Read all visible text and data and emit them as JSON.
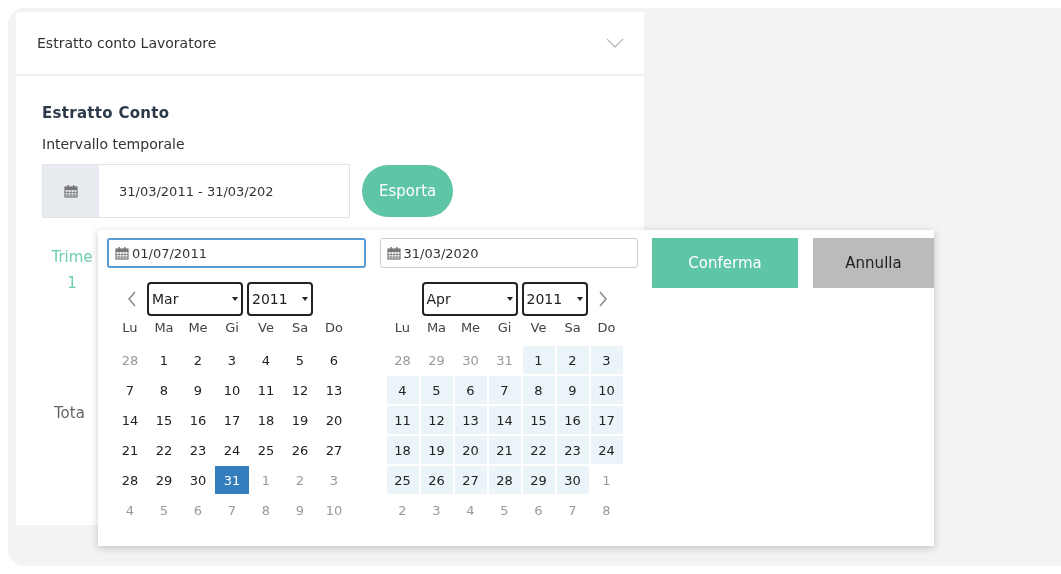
{
  "card": {
    "title": "Estratto conto Lavoratore",
    "expanded": false
  },
  "section": {
    "heading": "Estratto Conto",
    "label": "Intervallo temporale",
    "range_value": "31/03/2011 - 31/03/202",
    "export_button": "Esporta"
  },
  "behind": {
    "column_1_header": "Trime",
    "column_1_value": "1",
    "total_label": "Tota"
  },
  "picker": {
    "start_value": "01/07/2011",
    "end_value": "31/03/2020",
    "confirm_button": "Conferma",
    "cancel_button": "Annulla",
    "calendars": [
      {
        "month": "Mar",
        "year": "2011",
        "weekdays": [
          "Lu",
          "Ma",
          "Me",
          "Gi",
          "Ve",
          "Sa",
          "Do"
        ],
        "days": [
          {
            "d": "28",
            "kind": "off"
          },
          {
            "d": "1",
            "kind": "day"
          },
          {
            "d": "2",
            "kind": "day"
          },
          {
            "d": "3",
            "kind": "day"
          },
          {
            "d": "4",
            "kind": "day"
          },
          {
            "d": "5",
            "kind": "day"
          },
          {
            "d": "6",
            "kind": "day"
          },
          {
            "d": "7",
            "kind": "day"
          },
          {
            "d": "8",
            "kind": "day"
          },
          {
            "d": "9",
            "kind": "day"
          },
          {
            "d": "10",
            "kind": "day"
          },
          {
            "d": "11",
            "kind": "day"
          },
          {
            "d": "12",
            "kind": "day"
          },
          {
            "d": "13",
            "kind": "day"
          },
          {
            "d": "14",
            "kind": "day"
          },
          {
            "d": "15",
            "kind": "day"
          },
          {
            "d": "16",
            "kind": "day"
          },
          {
            "d": "17",
            "kind": "day"
          },
          {
            "d": "18",
            "kind": "day"
          },
          {
            "d": "19",
            "kind": "day"
          },
          {
            "d": "20",
            "kind": "day"
          },
          {
            "d": "21",
            "kind": "day"
          },
          {
            "d": "22",
            "kind": "day"
          },
          {
            "d": "23",
            "kind": "day"
          },
          {
            "d": "24",
            "kind": "day"
          },
          {
            "d": "25",
            "kind": "day"
          },
          {
            "d": "26",
            "kind": "day"
          },
          {
            "d": "27",
            "kind": "day"
          },
          {
            "d": "28",
            "kind": "day"
          },
          {
            "d": "29",
            "kind": "day"
          },
          {
            "d": "30",
            "kind": "day"
          },
          {
            "d": "31",
            "kind": "selected"
          },
          {
            "d": "1",
            "kind": "off"
          },
          {
            "d": "2",
            "kind": "off"
          },
          {
            "d": "3",
            "kind": "off"
          },
          {
            "d": "4",
            "kind": "off"
          },
          {
            "d": "5",
            "kind": "off"
          },
          {
            "d": "6",
            "kind": "off"
          },
          {
            "d": "7",
            "kind": "off"
          },
          {
            "d": "8",
            "kind": "off"
          },
          {
            "d": "9",
            "kind": "off"
          },
          {
            "d": "10",
            "kind": "off"
          }
        ]
      },
      {
        "month": "Apr",
        "year": "2011",
        "weekdays": [
          "Lu",
          "Ma",
          "Me",
          "Gi",
          "Ve",
          "Sa",
          "Do"
        ],
        "days": [
          {
            "d": "28",
            "kind": "off"
          },
          {
            "d": "29",
            "kind": "off"
          },
          {
            "d": "30",
            "kind": "off"
          },
          {
            "d": "31",
            "kind": "off"
          },
          {
            "d": "1",
            "kind": "range"
          },
          {
            "d": "2",
            "kind": "range"
          },
          {
            "d": "3",
            "kind": "range"
          },
          {
            "d": "4",
            "kind": "range"
          },
          {
            "d": "5",
            "kind": "range"
          },
          {
            "d": "6",
            "kind": "range"
          },
          {
            "d": "7",
            "kind": "range"
          },
          {
            "d": "8",
            "kind": "range"
          },
          {
            "d": "9",
            "kind": "range"
          },
          {
            "d": "10",
            "kind": "range"
          },
          {
            "d": "11",
            "kind": "range"
          },
          {
            "d": "12",
            "kind": "range"
          },
          {
            "d": "13",
            "kind": "range"
          },
          {
            "d": "14",
            "kind": "range"
          },
          {
            "d": "15",
            "kind": "range"
          },
          {
            "d": "16",
            "kind": "range"
          },
          {
            "d": "17",
            "kind": "range"
          },
          {
            "d": "18",
            "kind": "range"
          },
          {
            "d": "19",
            "kind": "range"
          },
          {
            "d": "20",
            "kind": "range"
          },
          {
            "d": "21",
            "kind": "range"
          },
          {
            "d": "22",
            "kind": "range"
          },
          {
            "d": "23",
            "kind": "range"
          },
          {
            "d": "24",
            "kind": "range"
          },
          {
            "d": "25",
            "kind": "range"
          },
          {
            "d": "26",
            "kind": "range"
          },
          {
            "d": "27",
            "kind": "range"
          },
          {
            "d": "28",
            "kind": "range"
          },
          {
            "d": "29",
            "kind": "range"
          },
          {
            "d": "30",
            "kind": "range"
          },
          {
            "d": "1",
            "kind": "off"
          },
          {
            "d": "2",
            "kind": "off"
          },
          {
            "d": "3",
            "kind": "off"
          },
          {
            "d": "4",
            "kind": "off"
          },
          {
            "d": "5",
            "kind": "off"
          },
          {
            "d": "6",
            "kind": "off"
          },
          {
            "d": "7",
            "kind": "off"
          },
          {
            "d": "8",
            "kind": "off"
          }
        ]
      }
    ]
  }
}
